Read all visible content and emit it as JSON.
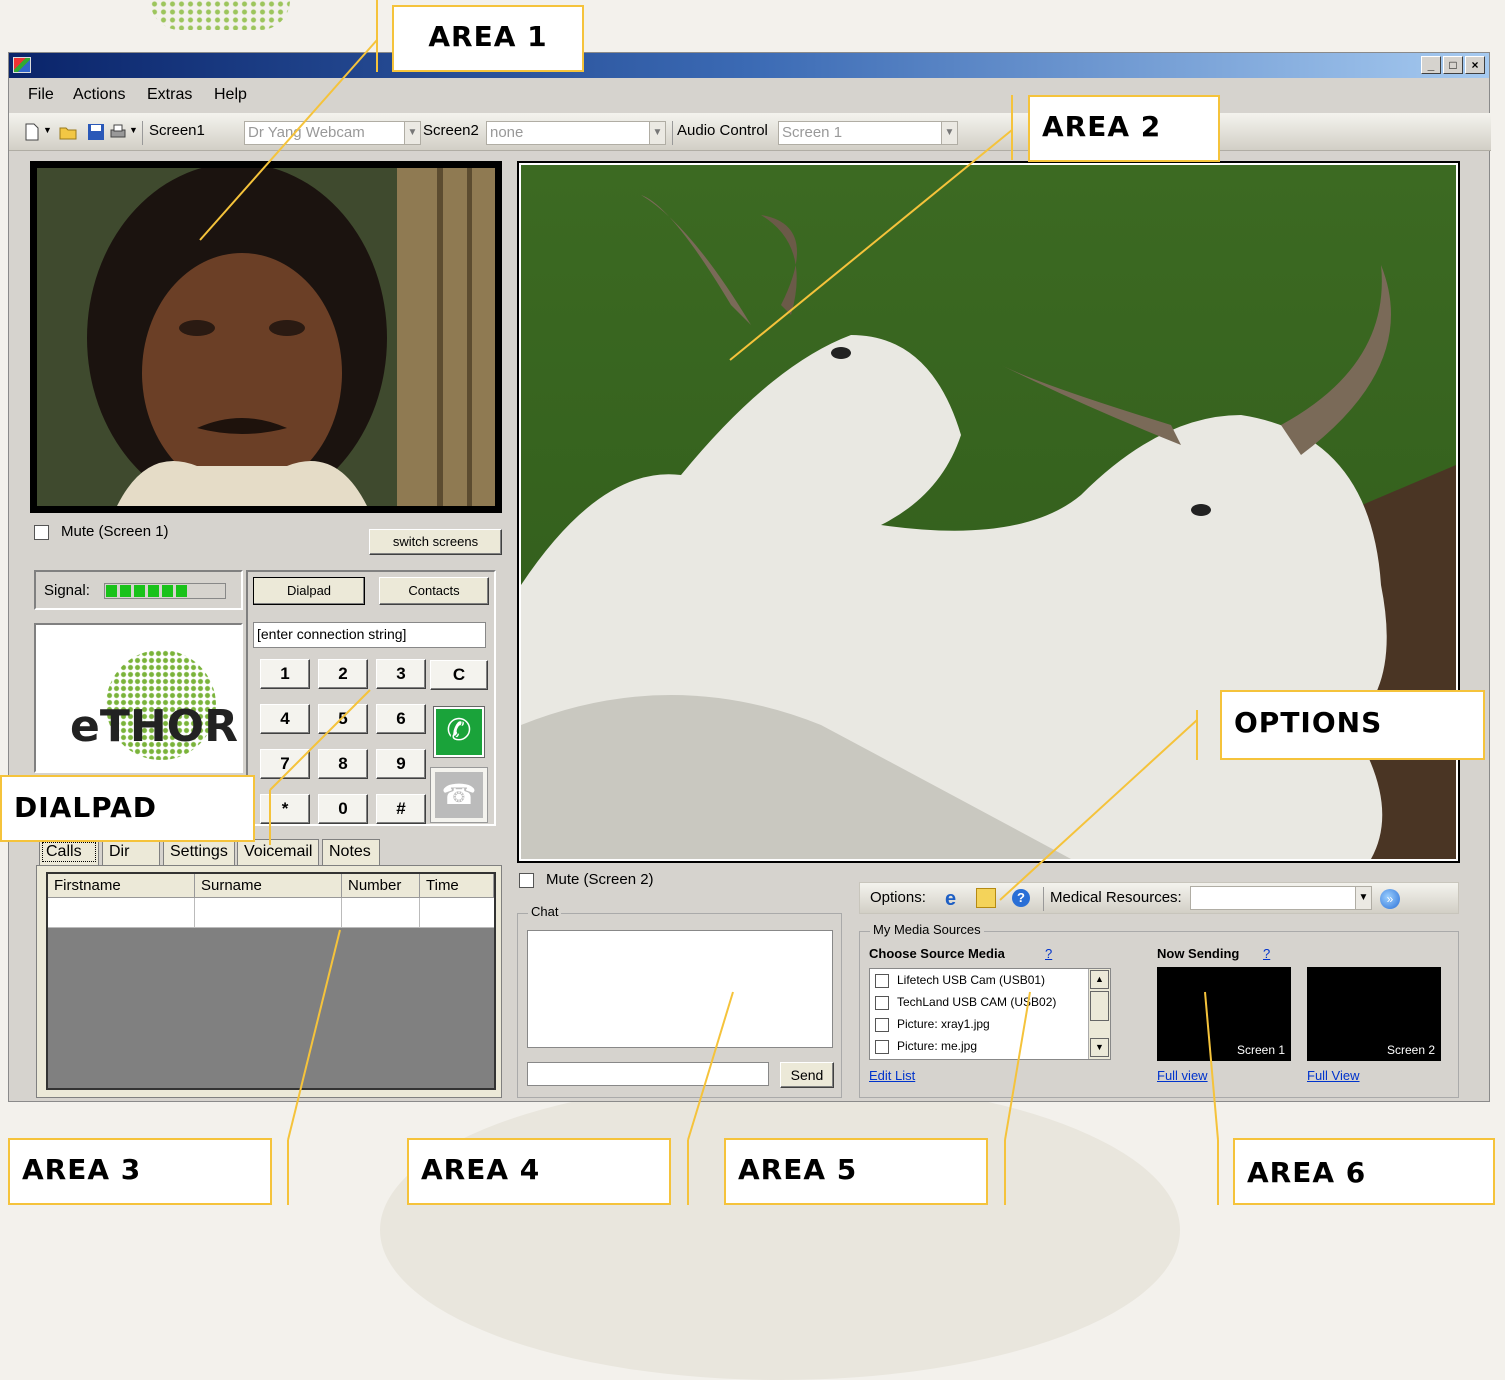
{
  "window": {
    "title": "",
    "controls": [
      "_",
      "□",
      "×"
    ]
  },
  "menubar": {
    "items": [
      {
        "label": "File"
      },
      {
        "label": "Actions"
      },
      {
        "label": "Extras"
      },
      {
        "label": "Help"
      }
    ]
  },
  "toolbar": {
    "icons": [
      "new-document-icon",
      "open-folder-icon",
      "save-disk-icon",
      "print-icon"
    ],
    "screen1_label": "Screen1",
    "screen1_value": "Dr Yang Webcam",
    "screen2_label": "Screen2",
    "screen2_value": "none",
    "audio_label": "Audio Control",
    "audio_value": "Screen 1"
  },
  "area1": {
    "mute_label": "Mute (Screen 1)",
    "switch_label": "switch screens",
    "video_desc_icon": "webcam-video-feed"
  },
  "signal": {
    "label": "Signal:",
    "level": 0.7,
    "bars_filled": 6
  },
  "logo": {
    "text": "eTHOR",
    "brand_color": "#7ab33a"
  },
  "dialpad": {
    "tab_dialpad": "Dialpad",
    "tab_contacts": "Contacts",
    "connection_value": "[enter connection string]",
    "keys": [
      "1",
      "2",
      "3",
      "4",
      "5",
      "6",
      "7",
      "8",
      "9",
      "*",
      "0",
      "#"
    ],
    "clear_label": "C",
    "call_icon": "phone-call-icon",
    "hangup_icon": "phone-hangup-icon",
    "call_color": "#1aa33a"
  },
  "tabs": {
    "items": [
      {
        "label": "Calls"
      },
      {
        "label": "Dir"
      },
      {
        "label": "Settings"
      },
      {
        "label": "Voicemail"
      },
      {
        "label": "Notes"
      }
    ],
    "active": "Calls"
  },
  "calls_table": {
    "columns": [
      "Firstname",
      "Surname",
      "Number",
      "Time"
    ]
  },
  "area2": {
    "mute_label": "Mute (Screen 2)",
    "image_icon": "bull-image"
  },
  "chat": {
    "legend": "Chat",
    "send_label": "Send"
  },
  "options_bar": {
    "options_label": "Options:",
    "icons": [
      "internet-explorer-icon",
      "contacts-card-icon",
      "help-icon"
    ],
    "medical_label": "Medical Resources:",
    "medical_value": "",
    "go_icon": "go-arrow-icon"
  },
  "media_sources": {
    "legend": "My Media Sources",
    "choose_label": "Choose Source Media",
    "choose_help": "?",
    "items": [
      {
        "label": "Lifetech USB Cam (USB01)"
      },
      {
        "label": "TechLand USB CAM (USB02)"
      },
      {
        "label": "Picture: xray1.jpg"
      },
      {
        "label": "Picture: me.jpg"
      }
    ],
    "edit_label": "Edit List",
    "now_sending_label": "Now Sending",
    "now_sending_help": "?",
    "screen1_label": "Screen 1",
    "screen2_label": "Screen 2",
    "full_view_1": "Full view",
    "full_view_2": "Full View"
  },
  "callouts": {
    "area1": "AREA 1",
    "area2": "AREA 2",
    "area3": "AREA 3",
    "area4": "AREA 4",
    "area5": "AREA 5",
    "area6": "AREA 6",
    "dialpad": "DIALPAD",
    "options": "OPTIONS",
    "callout_color": "#f5c33b"
  }
}
